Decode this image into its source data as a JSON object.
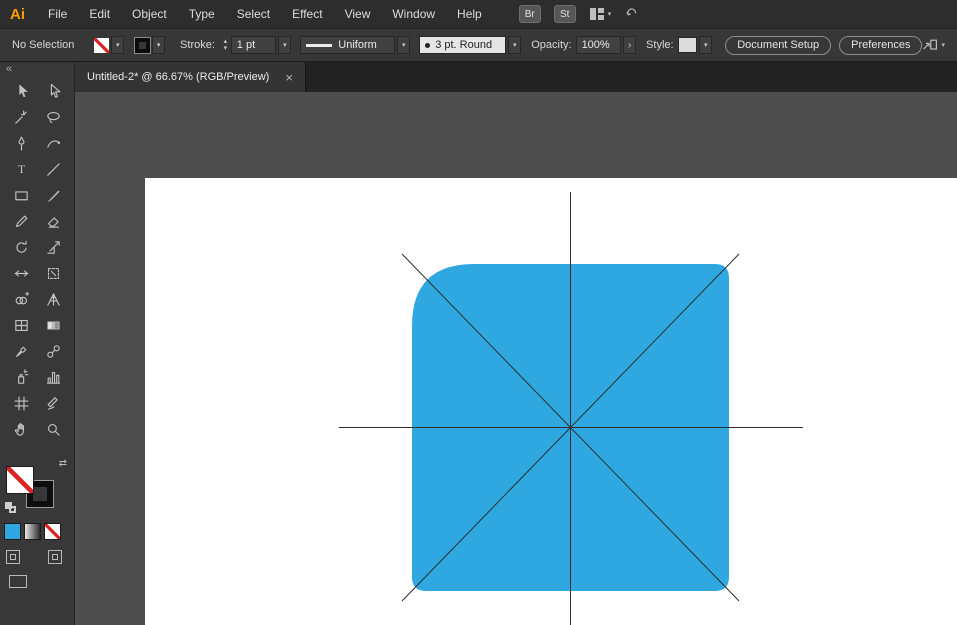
{
  "app": {
    "logo_text": "Ai"
  },
  "menubar": {
    "items": [
      "File",
      "Edit",
      "Object",
      "Type",
      "Select",
      "Effect",
      "View",
      "Window",
      "Help"
    ],
    "bridge_badge": "Br",
    "stock_badge": "St"
  },
  "controlbar": {
    "selection_status": "No Selection",
    "stroke_label": "Stroke:",
    "stroke_weight": "1 pt",
    "variable_width_profile": "Uniform",
    "brush_definition": "3 pt. Round",
    "opacity_label": "Opacity:",
    "opacity_value": "100%",
    "style_label": "Style:",
    "document_setup_button": "Document Setup",
    "preferences_button": "Preferences"
  },
  "document_tab": {
    "title": "Untitled-2* @ 66.67% (RGB/Preview)",
    "close_glyph": "×"
  },
  "toolbar": {
    "collapse_glyph": "«",
    "tools": [
      "selection",
      "direct-selection",
      "magic-wand",
      "lasso",
      "pen",
      "curvature",
      "type",
      "line-segment",
      "rectangle",
      "paintbrush",
      "pencil",
      "eraser",
      "rotate",
      "scale",
      "width",
      "free-transform",
      "shape-builder",
      "perspective-grid",
      "mesh",
      "gradient",
      "eyedropper",
      "blend",
      "symbol-sprayer",
      "column-graph",
      "artboard",
      "slice",
      "hand",
      "zoom"
    ],
    "fill_type_swatches": [
      "color",
      "gradient",
      "none"
    ]
  },
  "glyphs": {
    "chevron_down": "▾",
    "chevron_up": "▴",
    "chevron_right": "›",
    "swap": "⇄"
  },
  "colors": {
    "accent_blue": "#2FA8E1",
    "none_slash_red": "#DD2222",
    "canvas_gray": "#4E4E4E",
    "artboard_white": "#FFFFFF"
  },
  "canvas": {
    "shape": "rounded-square-with-large-top-left-corner",
    "guides": [
      "diagonal-tl-br",
      "diagonal-tr-bl",
      "horizontal-center",
      "vertical-center"
    ]
  }
}
